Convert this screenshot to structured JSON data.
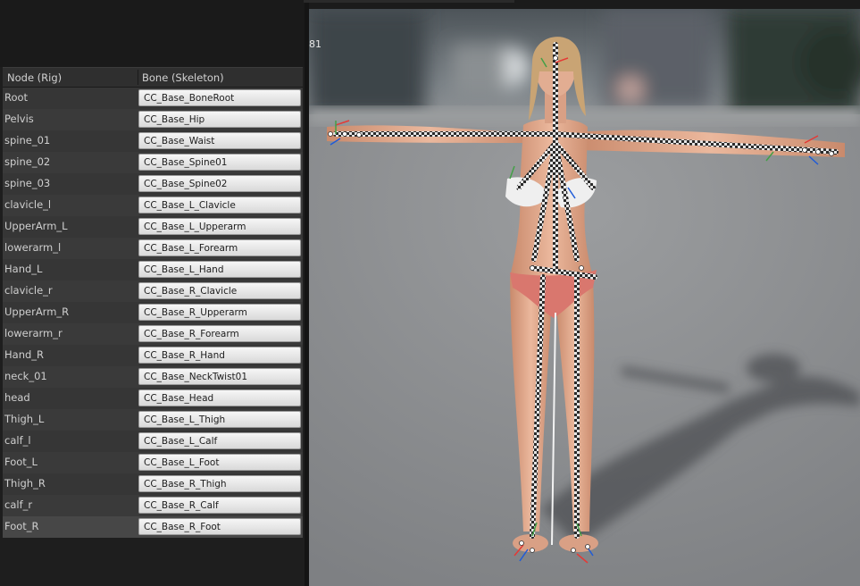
{
  "table": {
    "headers": {
      "node": "Node (Rig)",
      "bone": "Bone (Skeleton)"
    },
    "rows": [
      {
        "node": "Root",
        "bone": "CC_Base_BoneRoot"
      },
      {
        "node": "Pelvis",
        "bone": "CC_Base_Hip"
      },
      {
        "node": "spine_01",
        "bone": "CC_Base_Waist"
      },
      {
        "node": "spine_02",
        "bone": "CC_Base_Spine01"
      },
      {
        "node": "spine_03",
        "bone": "CC_Base_Spine02"
      },
      {
        "node": "clavicle_l",
        "bone": "CC_Base_L_Clavicle"
      },
      {
        "node": "UpperArm_L",
        "bone": "CC_Base_L_Upperarm"
      },
      {
        "node": "lowerarm_l",
        "bone": "CC_Base_L_Forearm"
      },
      {
        "node": "Hand_L",
        "bone": "CC_Base_L_Hand"
      },
      {
        "node": "clavicle_r",
        "bone": "CC_Base_R_Clavicle"
      },
      {
        "node": "UpperArm_R",
        "bone": "CC_Base_R_Upperarm"
      },
      {
        "node": "lowerarm_r",
        "bone": "CC_Base_R_Forearm"
      },
      {
        "node": "Hand_R",
        "bone": "CC_Base_R_Hand"
      },
      {
        "node": "neck_01",
        "bone": "CC_Base_NeckTwist01"
      },
      {
        "node": "head",
        "bone": "CC_Base_Head"
      },
      {
        "node": "Thigh_L",
        "bone": "CC_Base_L_Thigh"
      },
      {
        "node": "calf_l",
        "bone": "CC_Base_L_Calf"
      },
      {
        "node": "Foot_L",
        "bone": "CC_Base_L_Foot"
      },
      {
        "node": "Thigh_R",
        "bone": "CC_Base_R_Thigh"
      },
      {
        "node": "calf_r",
        "bone": "CC_Base_R_Calf"
      },
      {
        "node": "Foot_R",
        "bone": "CC_Base_R_Foot"
      }
    ],
    "selected_row": "Foot_R"
  },
  "viewport": {
    "frame_label": "81"
  },
  "colors": {
    "panel_bg": "#1e1e1e",
    "row_bg": "#3a3a3a",
    "selected_row_bg": "#474747",
    "bone_button_bg": "#eaeaea",
    "skin": "#e2a98c",
    "swimsuit_top": "#efefef",
    "swimsuit_bottom": "#d9776e",
    "hair": "#c9a474",
    "floor": "#8c8e91"
  }
}
